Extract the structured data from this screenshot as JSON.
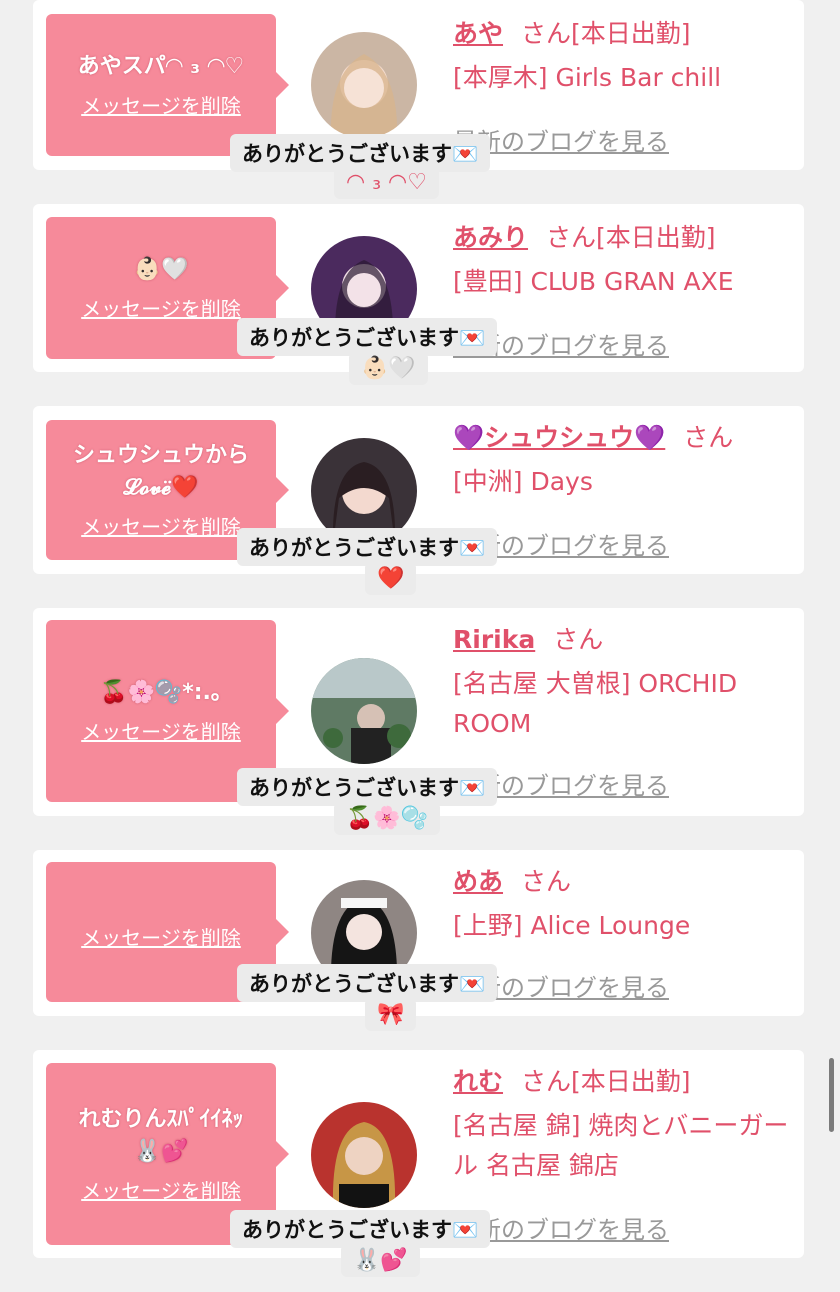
{
  "delete_label": "メッセージを削除",
  "san": "さん",
  "blog_label": "最新のブログを見る",
  "thanks": "ありがとうございます💌",
  "colors": {
    "bubble": "#f68a9a",
    "accent": "#e0506a",
    "background": "#f0f0f0"
  },
  "entries": [
    {
      "bubble_text": "あやスパ◠ ₃ ◠♡",
      "name": "あや",
      "status": "[本日出勤]",
      "shop": "[本厚木] Girls Bar chill",
      "reply": "◠ ₃ ◠♡"
    },
    {
      "bubble_text": "👶🏻🤍",
      "name": "あみり",
      "status": "[本日出勤]",
      "shop": "[豊田] CLUB GRAN AXE",
      "reply": "👶🏻🤍"
    },
    {
      "bubble_text": "シュウシュウから\n𝓛𝓸𝓿𝓮̈❤️",
      "name": "💜シュウシュウ💜",
      "status": "",
      "shop": "[中洲] Days",
      "reply": "❤️"
    },
    {
      "bubble_text": "🍒🌸🫧*:.｡",
      "name": "Ririka",
      "status": "",
      "shop": "[名古屋 大曽根] ORCHID ROOM",
      "reply": "🍒🌸🫧"
    },
    {
      "bubble_text": "",
      "name": "めあ",
      "status": "",
      "shop": "[上野] Alice Lounge",
      "reply": "🎀"
    },
    {
      "bubble_text": "れむりんｽﾊﾟｲｲﾈｯ\n🐰💕",
      "name": "れむ",
      "status": "[本日出勤]",
      "shop": "[名古屋 錦] 焼肉とバニーガール 名古屋 錦店",
      "reply": "🐰💕"
    }
  ]
}
